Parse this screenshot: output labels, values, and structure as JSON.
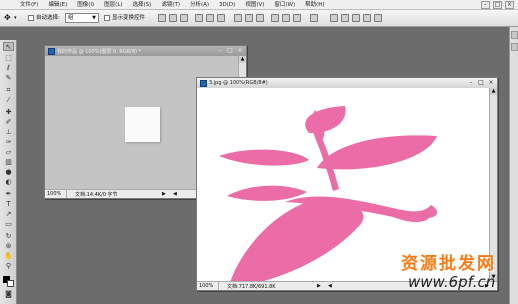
{
  "menu": {
    "items": [
      "文件(F)",
      "编辑(E)",
      "图像(I)",
      "图层(L)",
      "选择(S)",
      "滤镜(T)",
      "分析(A)",
      "3D(D)",
      "视图(V)",
      "窗口(W)",
      "帮助(H)"
    ],
    "window_controls": [
      "–",
      "□",
      "×"
    ]
  },
  "options": {
    "auto_select_label": "自动选择:",
    "auto_select_value": "组",
    "show_transform_label": "显示变换控件"
  },
  "doc1": {
    "title": "我的作品 @ 100%(图层 0, RGB/8) *",
    "zoom": "100%",
    "status": "文档:14.4K/0 字节",
    "canvas_color": "#c4c4c4",
    "image_color": "#fbfbfb"
  },
  "doc2": {
    "title": "3.jpg @ 100%(RGB/8#)",
    "zoom": "100%",
    "status": "文档:717.8K/691.8K",
    "canvas_color": "#ffffff",
    "shape_color": "#ec6ca7"
  },
  "watermark": {
    "line1": "资源批发网",
    "line2": "www.6pf.cn"
  }
}
